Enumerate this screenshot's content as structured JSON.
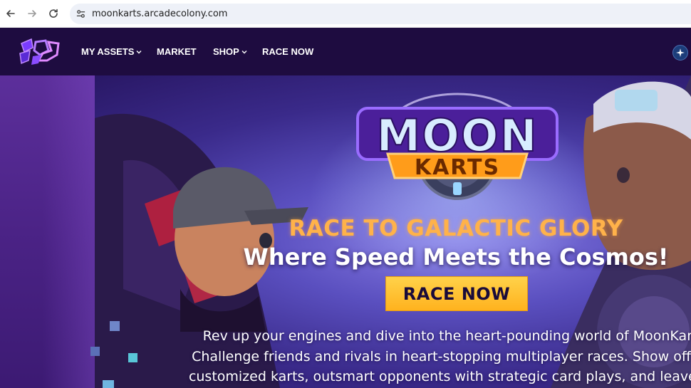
{
  "browser": {
    "url": "moonkarts.arcadecolony.com",
    "icons": [
      "back-arrow-icon",
      "forward-arrow-icon",
      "reload-icon",
      "site-settings-icon"
    ]
  },
  "header": {
    "menu": [
      {
        "label": "MY ASSETS",
        "dropdown": true
      },
      {
        "label": "MARKET",
        "dropdown": false
      },
      {
        "label": "SHOP",
        "dropdown": true
      },
      {
        "label": "RACE NOW",
        "dropdown": false
      }
    ]
  },
  "hero": {
    "logo_text_top": "MOON",
    "logo_text_bottom": "KARTS",
    "tagline": "RACE TO GALACTIC GLORY",
    "subtitle": "Where Speed Meets the Cosmos!",
    "cta_label": "RACE NOW",
    "description_lines": [
      "Rev up your engines and dive into the heart-pounding world of MoonKarts.",
      "Challenge friends and rivals in heart-stopping multiplayer races. Show off you",
      "customized karts, outsmart opponents with strategic card plays, and leave the"
    ]
  },
  "colors": {
    "header_bg": "#1e0c40",
    "accent_orange": "#ffb24a",
    "cta_yellow": "#ffc93a"
  }
}
